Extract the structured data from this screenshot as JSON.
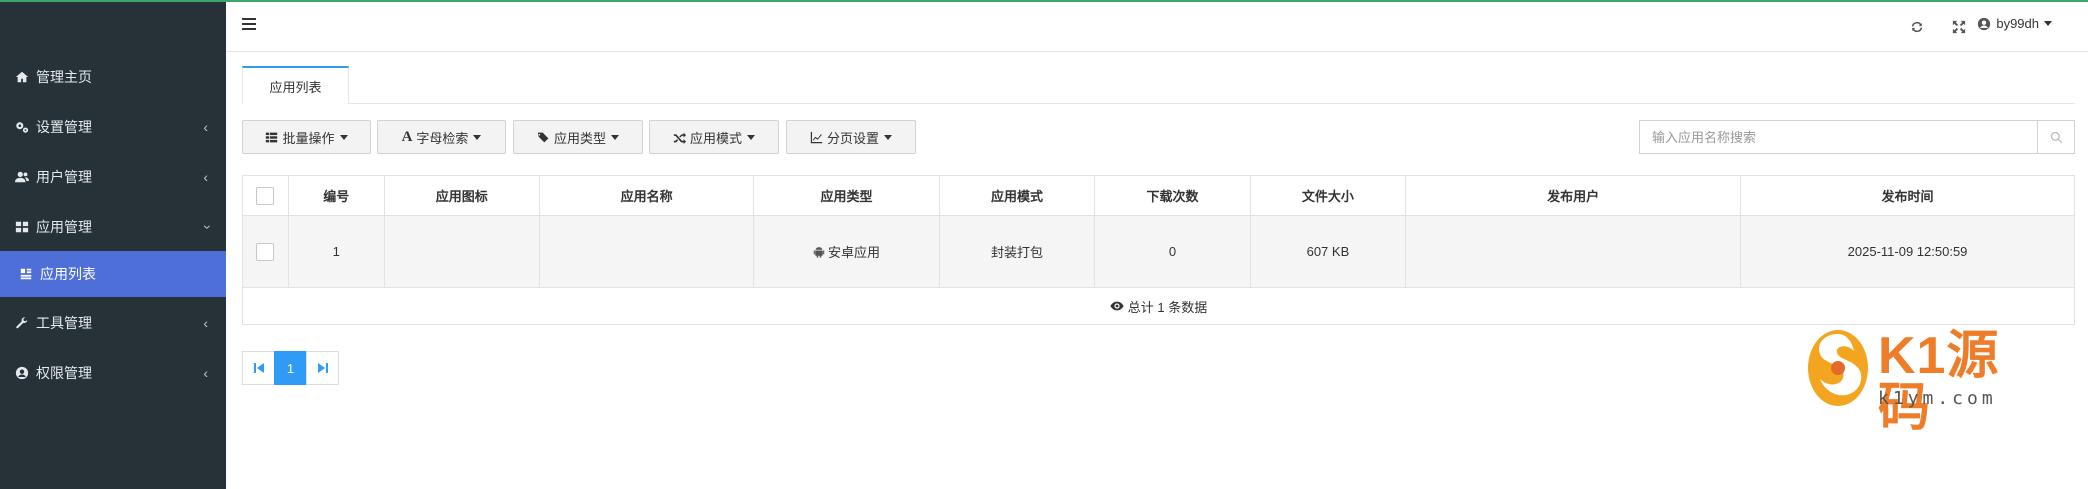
{
  "sidebar": {
    "items": [
      {
        "label": "管理主页",
        "icon": "home-icon"
      },
      {
        "label": "设置管理",
        "icon": "gears-icon"
      },
      {
        "label": "用户管理",
        "icon": "users-icon"
      },
      {
        "label": "应用管理",
        "icon": "th-icon"
      },
      {
        "label": "应用列表",
        "icon": "list-icon"
      },
      {
        "label": "工具管理",
        "icon": "wrench-icon"
      },
      {
        "label": "权限管理",
        "icon": "user-circle-icon"
      }
    ],
    "active_color": "#4e6fd7",
    "background": "#263238"
  },
  "header": {
    "username": "by99dh",
    "icons": [
      "menu-icon",
      "refresh-icon",
      "fullscreen-icon",
      "user-circle-icon"
    ]
  },
  "tabs": [
    {
      "label": "应用列表"
    }
  ],
  "toolbar": {
    "buttons": [
      {
        "label": "批量操作",
        "icon": "th-list-icon"
      },
      {
        "label": "字母检索",
        "icon": "font-icon"
      },
      {
        "label": "应用类型",
        "icon": "tags-icon"
      },
      {
        "label": "应用模式",
        "icon": "random-icon"
      },
      {
        "label": "分页设置",
        "icon": "line-chart-icon"
      }
    ],
    "search_placeholder": "输入应用名称搜索"
  },
  "table": {
    "headers": [
      "编号",
      "应用图标",
      "应用名称",
      "应用类型",
      "应用模式",
      "下载次数",
      "文件大小",
      "发布用户",
      "发布时间"
    ],
    "rows": [
      {
        "id": "1",
        "icon": "",
        "name": "",
        "type": "安卓应用",
        "mode": "封装打包",
        "downloads": "0",
        "size": "607 KB",
        "user": "",
        "time": "2025-11-09 12:50:59"
      }
    ],
    "footer": "总计 1 条数据"
  },
  "pagination": {
    "current": "1"
  },
  "watermark": {
    "brand": "K1源码",
    "domain": "k1ym.com"
  }
}
